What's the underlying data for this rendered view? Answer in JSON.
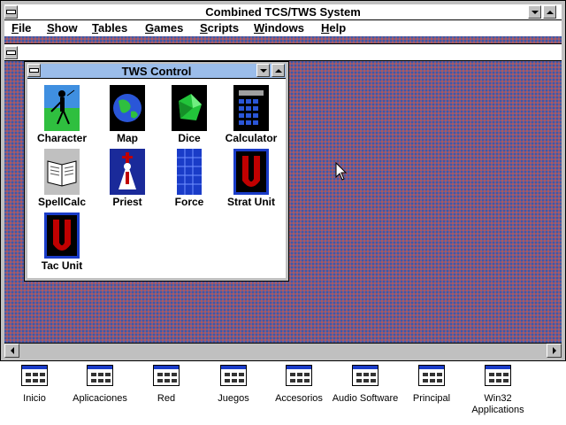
{
  "window": {
    "title": "Combined TCS/TWS System"
  },
  "menu": [
    "File",
    "Show",
    "Tables",
    "Games",
    "Scripts",
    "Windows",
    "Help"
  ],
  "tws_control": {
    "title": "TWS Control",
    "icons": [
      {
        "label": "Character",
        "icon": "character-icon"
      },
      {
        "label": "Map",
        "icon": "globe-icon"
      },
      {
        "label": "Dice",
        "icon": "dice-icon"
      },
      {
        "label": "Calculator",
        "icon": "calculator-icon"
      },
      {
        "label": "SpellCalc",
        "icon": "spellbook-icon"
      },
      {
        "label": "Priest",
        "icon": "priest-icon"
      },
      {
        "label": "Force",
        "icon": "force-grid-icon"
      },
      {
        "label": "Strat Unit",
        "icon": "unit-u-icon"
      },
      {
        "label": "Tac Unit",
        "icon": "unit-u-icon"
      }
    ]
  },
  "program_groups": [
    {
      "label": "Inicio"
    },
    {
      "label": "Aplicaciones"
    },
    {
      "label": "Red"
    },
    {
      "label": "Juegos"
    },
    {
      "label": "Accesorios"
    },
    {
      "label": "Audio Software"
    },
    {
      "label": "Principal"
    },
    {
      "label": "Win32 Applications"
    }
  ],
  "colors": {
    "desktop_pattern": "#7a5a8c",
    "active_child_title": "#9bbdea",
    "icon_blue": "#1a3cc8",
    "unit_red": "#c00000"
  }
}
